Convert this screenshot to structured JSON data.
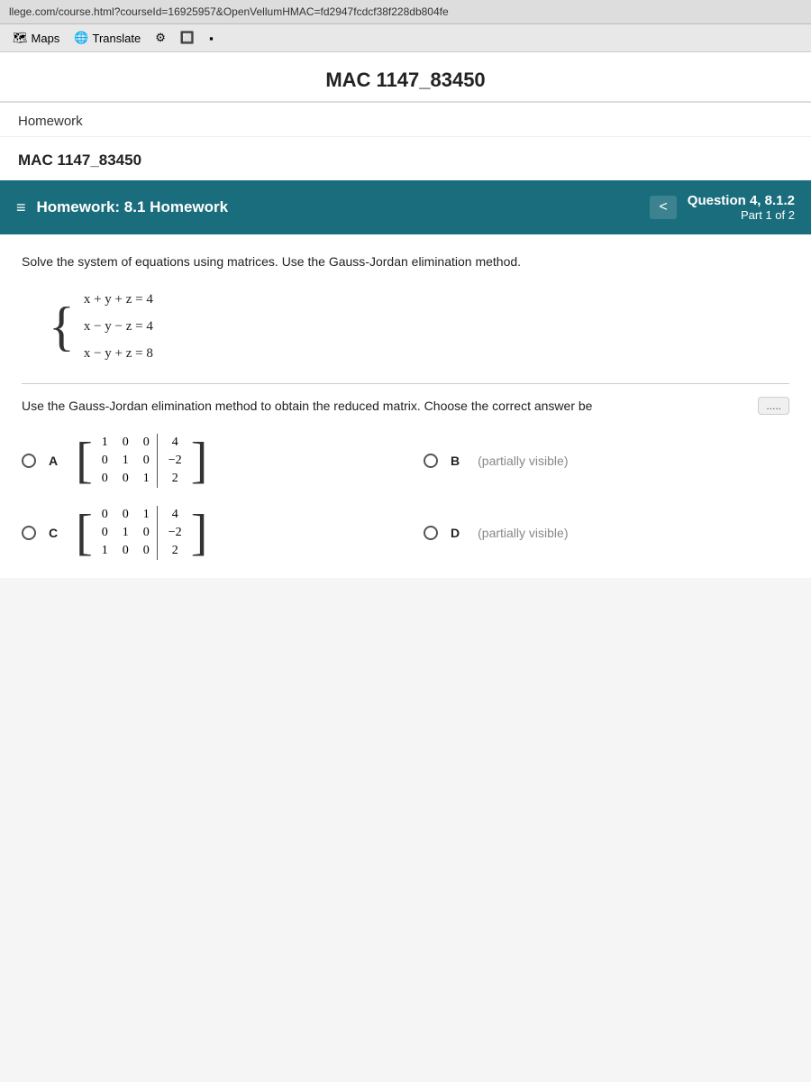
{
  "browser": {
    "url": "llege.com/course.html?courseId=16925957&OpenVellumHMAC=fd2947fcdcf38f228db804fe",
    "toolbar_items": [
      {
        "label": "Maps",
        "icon": "map-icon"
      },
      {
        "label": "Translate",
        "icon": "translate-icon"
      }
    ]
  },
  "course": {
    "title": "MAC 1147_83450",
    "section": "Homework",
    "inner_title": "MAC 1147_83450"
  },
  "homework_header": {
    "menu_icon": "≡",
    "title": "Homework: 8.1 Homework",
    "question_label": "Question 4, 8.1.2",
    "part_label": "Part 1 of 2",
    "nav_arrow": "<"
  },
  "question": {
    "instruction": "Solve the system of equations using matrices. Use the Gauss-Jordan elimination method.",
    "equations": [
      "x + y + z = 4",
      "x − y − z = 4",
      "x − y + z = 8"
    ],
    "sub_instruction": "Use the Gauss-Jordan elimination method to obtain the reduced matrix. Choose the correct answer be",
    "more_label": ".....",
    "choices": [
      {
        "id": "A",
        "matrix_rows": [
          [
            "1",
            "0",
            "0",
            "4"
          ],
          [
            "0",
            "1",
            "0",
            "-2"
          ],
          [
            "0",
            "0",
            "1",
            "2"
          ]
        ]
      },
      {
        "id": "B",
        "visible": false
      },
      {
        "id": "C",
        "matrix_rows": [
          [
            "0",
            "0",
            "1",
            "4"
          ],
          [
            "0",
            "1",
            "0",
            "-2"
          ],
          [
            "1",
            "0",
            "0",
            "2"
          ]
        ]
      },
      {
        "id": "D",
        "visible": false
      }
    ]
  }
}
